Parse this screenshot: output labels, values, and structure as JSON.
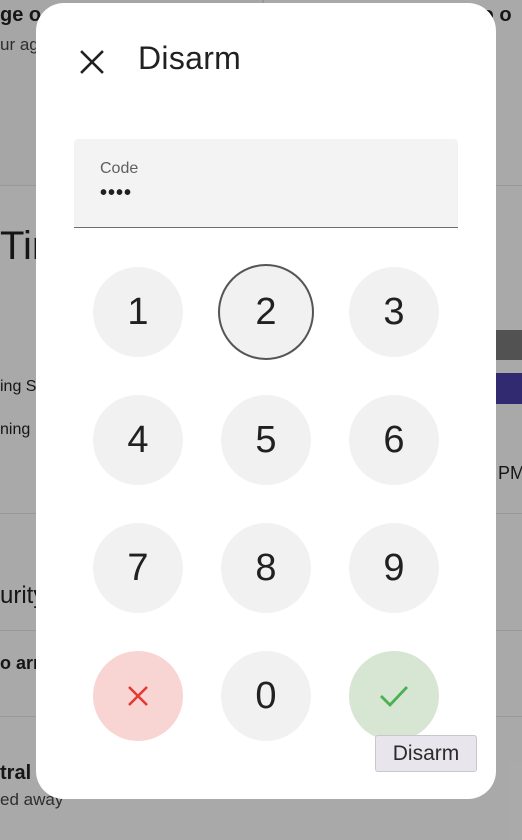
{
  "background": {
    "texts": [
      "ge o",
      "ur ag",
      "io o",
      "Tin",
      "ing S",
      "ning",
      "PM",
      "urity",
      "o arr",
      "tral S",
      "ed away"
    ],
    "accent_bar_color": "#4b3fa5",
    "gray_bar_color": "#7a7a7a"
  },
  "dialog": {
    "title": "Disarm",
    "close_icon": "close-icon",
    "code": {
      "label": "Code",
      "value": "••••"
    },
    "keys": [
      "1",
      "2",
      "3",
      "4",
      "5",
      "6",
      "7",
      "8",
      "9",
      "0"
    ],
    "clear_icon": "clear-icon",
    "submit_icon": "check-icon",
    "tooltip": "Disarm"
  },
  "colors": {
    "clear_bg": "#f8d5d2",
    "clear_fg": "#e53935",
    "submit_bg": "#d6e6d2",
    "submit_fg": "#4caf50"
  }
}
